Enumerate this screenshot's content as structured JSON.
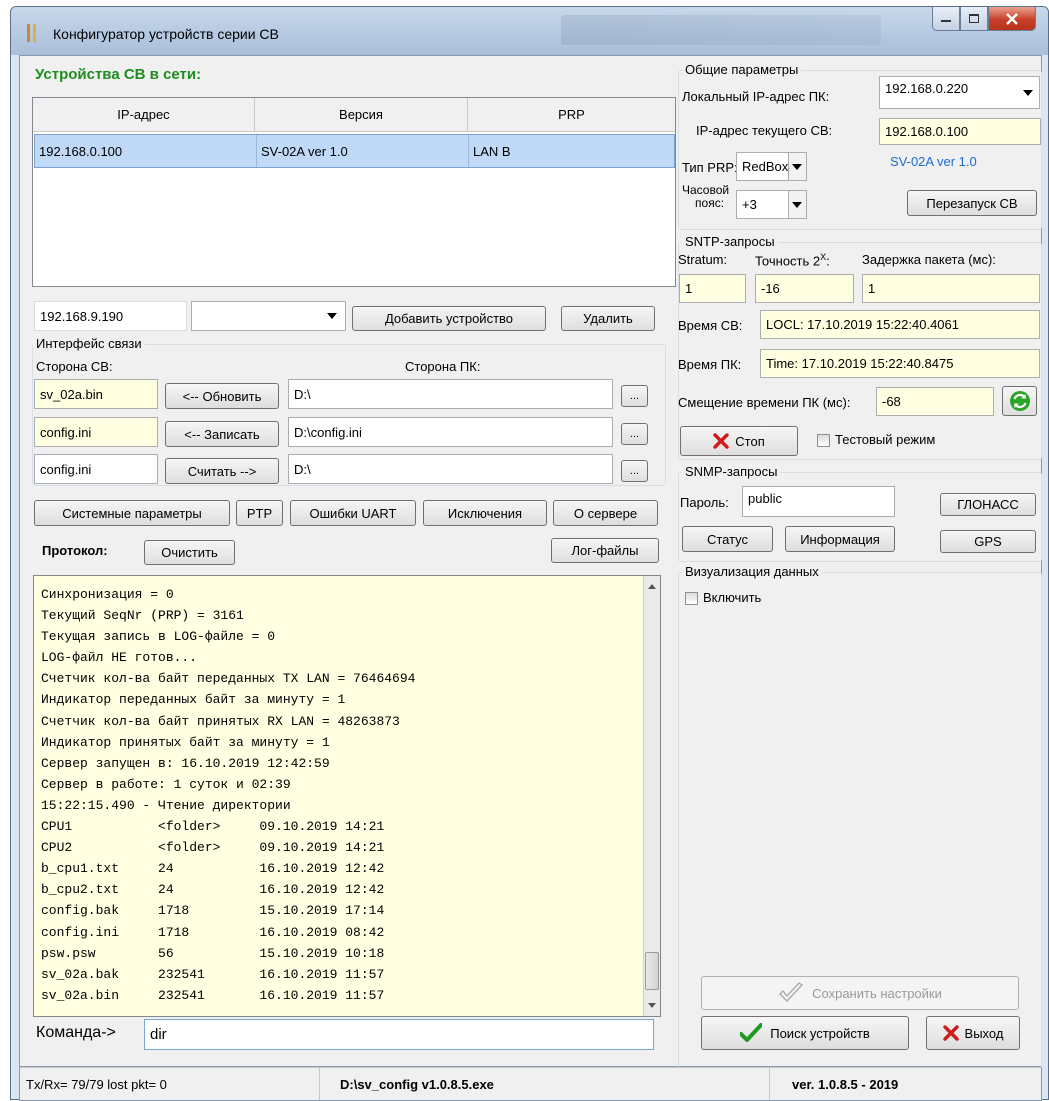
{
  "window": {
    "title": "Конфигуратор устройств серии СВ"
  },
  "devices": {
    "heading": "Устройства СВ в сети:",
    "columns": [
      "IP-адрес",
      "Версия",
      "PRP"
    ],
    "rows": [
      {
        "ip": "192.168.0.100",
        "version": "SV-02A ver 1.0",
        "prp": "LAN B"
      }
    ],
    "new_ip_value": "192.168.9.190",
    "combo_value": "",
    "add_label": "Добавить устройство",
    "delete_label": "Удалить"
  },
  "interface": {
    "title": "Интерфейс связи",
    "sv_side_label": "Сторона СВ:",
    "pc_side_label": "Сторона ПК:",
    "rows": [
      {
        "sv_file": "sv_02a.bin",
        "action": "<-- Обновить",
        "pc_path": "D:\\",
        "browse": "..."
      },
      {
        "sv_file": "config.ini",
        "action": "<-- Записать",
        "pc_path": "D:\\config.ini",
        "browse": "..."
      },
      {
        "sv_file": "config.ini",
        "action": "Считать -->",
        "pc_path": "D:\\",
        "browse": "..."
      }
    ]
  },
  "toolbar": {
    "system_params": "Системные параметры",
    "ptp": "PTP",
    "uart_errors": "Ошибки UART",
    "exceptions": "Исключения",
    "about_server": "О сервере"
  },
  "protocol": {
    "label": "Протокол:",
    "clear": "Очистить",
    "log_files": "Лог-файлы",
    "lines": [
      "Синхронизация = 0",
      "Текущий SeqNr (PRP) = 3161",
      "Текущая запись в LOG-файле = 0",
      "LOG-файл НЕ готов...",
      "Счетчик кол-ва байт переданных TX LAN = 76464694",
      "Индикатор переданных байт за минуту = 1",
      "Счетчик кол-ва байт принятых RX LAN = 48263873",
      "Индикатор принятых байт за минуту = 1",
      "Сервер запущен в: 16.10.2019 12:42:59",
      "Сервер в работе: 1 суток и 02:39",
      "15:22:15.490 - Чтение директории",
      "CPU1           <folder>     09.10.2019 14:21",
      "CPU2           <folder>     09.10.2019 14:21",
      "b_cpu1.txt     24           16.10.2019 12:42",
      "b_cpu2.txt     24           16.10.2019 12:42",
      "config.bak     1718         15.10.2019 17:14",
      "config.ini     1718         16.10.2019 08:42",
      "psw.psw        56           15.10.2019 10:18",
      "sv_02a.bak     232541       16.10.2019 11:57",
      "sv_02a.bin     232541       16.10.2019 11:57"
    ],
    "command_label": "Команда->",
    "command_value": "dir"
  },
  "general": {
    "title": "Общие параметры",
    "local_ip_label": "Локальный IP-адрес ПК:",
    "local_ip_value": "192.168.0.220",
    "current_ip_label": "IP-адрес текущего СВ:",
    "current_ip_value": "192.168.0.100",
    "prp_type_label": "Тип PRP:",
    "prp_type_value": "RedBox",
    "device_version": "SV-02A ver 1.0",
    "timezone_label_1": "Часовой",
    "timezone_label_2": "пояс:",
    "timezone_value": "+3",
    "restart": "Перезапуск СВ"
  },
  "sntp": {
    "title": "SNTP-запросы",
    "stratum_label": "Stratum:",
    "precision_label": "Точность 2",
    "precision_sup": "X",
    "precision_colon": ":",
    "delay_label": "Задержка пакета (мс):",
    "stratum_value": "1",
    "precision_value": "-16",
    "delay_value": "1",
    "sv_time_label": "Время СВ:",
    "sv_time_value": "LOCL:  17.10.2019 15:22:40.4061",
    "pc_time_label": "Время ПК:",
    "pc_time_value": "Time:  17.10.2019 15:22:40.8475",
    "offset_label": "Смещение времени ПК (мс):",
    "offset_value": "-68",
    "stop": "Стоп",
    "test_mode": "Тестовый режим"
  },
  "snmp": {
    "title": "SNMP-запросы",
    "password_label": "Пароль:",
    "password_value": "public",
    "glonass": "ГЛОНАСС",
    "status": "Статус",
    "info": "Информация",
    "gps": "GPS"
  },
  "visual": {
    "title": "Визуализация данных",
    "enable": "Включить"
  },
  "actions": {
    "save": "Сохранить настройки",
    "search": "Поиск устройств",
    "exit": "Выход"
  },
  "status": {
    "txrx": "Tx/Rx= 79/79   lost pkt= 0",
    "path": "D:\\sv_config v1.0.8.5.exe",
    "version": "ver. 1.0.8.5 - 2019"
  },
  "colors": {
    "heading_green": "#1f8c1f",
    "version_blue": "#1c6fd1",
    "selection": "#bfd9f6",
    "yellow_field": "#ffffe1"
  }
}
